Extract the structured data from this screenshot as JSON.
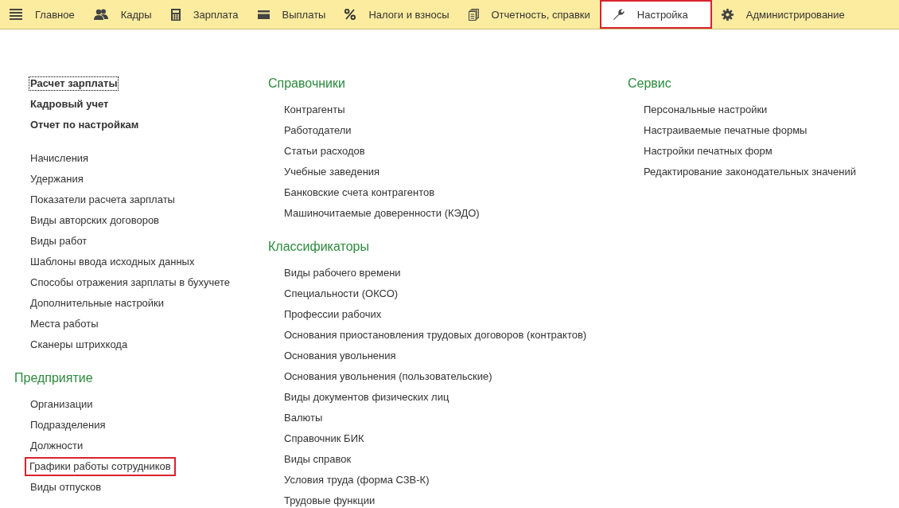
{
  "tabs": [
    {
      "label": "Главное",
      "selected": false,
      "highlighted": false
    },
    {
      "label": "Кадры",
      "selected": false,
      "highlighted": false
    },
    {
      "label": "Зарплата",
      "selected": false,
      "highlighted": false
    },
    {
      "label": "Выплаты",
      "selected": false,
      "highlighted": false
    },
    {
      "label": "Налоги и взносы",
      "selected": false,
      "highlighted": false
    },
    {
      "label": "Отчетность, справки",
      "selected": false,
      "highlighted": false
    },
    {
      "label": "Настройка",
      "selected": true,
      "highlighted": true
    },
    {
      "label": "Администрирование",
      "selected": false,
      "highlighted": false
    }
  ],
  "columns": [
    {
      "sections": [
        {
          "kind": "featured",
          "items": [
            {
              "label": "Расчет зарплаты",
              "focused": true,
              "highlighted": false
            },
            {
              "label": "Кадровый учет",
              "focused": false,
              "highlighted": false
            },
            {
              "label": "Отчет по настройкам",
              "focused": false,
              "highlighted": false
            }
          ]
        },
        {
          "kind": "plain",
          "items": [
            {
              "label": "Начисления",
              "focused": false,
              "highlighted": false
            },
            {
              "label": "Удержания",
              "focused": false,
              "highlighted": false
            },
            {
              "label": "Показатели расчета зарплаты",
              "focused": false,
              "highlighted": false
            },
            {
              "label": "Виды авторских договоров",
              "focused": false,
              "highlighted": false
            },
            {
              "label": "Виды работ",
              "focused": false,
              "highlighted": false
            },
            {
              "label": "Шаблоны ввода исходных данных",
              "focused": false,
              "highlighted": false
            },
            {
              "label": "Способы отражения зарплаты в бухучете",
              "focused": false,
              "highlighted": false
            },
            {
              "label": "Дополнительные настройки",
              "focused": false,
              "highlighted": false
            },
            {
              "label": "Места работы",
              "focused": false,
              "highlighted": false
            },
            {
              "label": "Сканеры штрихкода",
              "focused": false,
              "highlighted": false
            }
          ]
        },
        {
          "kind": "plain",
          "title": "Предприятие",
          "items": [
            {
              "label": "Организации",
              "focused": false,
              "highlighted": false
            },
            {
              "label": "Подразделения",
              "focused": false,
              "highlighted": false
            },
            {
              "label": "Должности",
              "focused": false,
              "highlighted": false
            },
            {
              "label": "Графики работы сотрудников",
              "focused": false,
              "highlighted": true
            },
            {
              "label": "Виды отпусков",
              "focused": false,
              "highlighted": false
            }
          ]
        }
      ]
    },
    {
      "sections": [
        {
          "kind": "plain",
          "title": "Справочники",
          "items": [
            {
              "label": "Контрагенты",
              "focused": false,
              "highlighted": false
            },
            {
              "label": "Работодатели",
              "focused": false,
              "highlighted": false
            },
            {
              "label": "Статьи расходов",
              "focused": false,
              "highlighted": false
            },
            {
              "label": "Учебные заведения",
              "focused": false,
              "highlighted": false
            },
            {
              "label": "Банковские счета контрагентов",
              "focused": false,
              "highlighted": false
            },
            {
              "label": "Машиночитаемые доверенности (КЭДО)",
              "focused": false,
              "highlighted": false
            }
          ]
        },
        {
          "kind": "plain",
          "title": "Классификаторы",
          "items": [
            {
              "label": "Виды рабочего времени",
              "focused": false,
              "highlighted": false
            },
            {
              "label": "Специальности (ОКСО)",
              "focused": false,
              "highlighted": false
            },
            {
              "label": "Профессии рабочих",
              "focused": false,
              "highlighted": false
            },
            {
              "label": "Основания приостановления трудовых договоров (контрактов)",
              "focused": false,
              "highlighted": false
            },
            {
              "label": "Основания увольнения",
              "focused": false,
              "highlighted": false
            },
            {
              "label": "Основания увольнения (пользовательские)",
              "focused": false,
              "highlighted": false
            },
            {
              "label": "Виды документов физических лиц",
              "focused": false,
              "highlighted": false
            },
            {
              "label": "Валюты",
              "focused": false,
              "highlighted": false
            },
            {
              "label": "Справочник БИК",
              "focused": false,
              "highlighted": false
            },
            {
              "label": "Виды справок",
              "focused": false,
              "highlighted": false
            },
            {
              "label": "Условия труда (форма СЗВ-К)",
              "focused": false,
              "highlighted": false
            },
            {
              "label": "Трудовые функции",
              "focused": false,
              "highlighted": false
            }
          ]
        }
      ]
    },
    {
      "sections": [
        {
          "kind": "plain",
          "title": "Сервис",
          "items": [
            {
              "label": "Персональные настройки",
              "focused": false,
              "highlighted": false
            },
            {
              "label": "Настраиваемые печатные формы",
              "focused": false,
              "highlighted": false
            },
            {
              "label": "Настройки печатных форм",
              "focused": false,
              "highlighted": false
            },
            {
              "label": "Редактирование законодательных значений",
              "focused": false,
              "highlighted": false
            }
          ]
        }
      ]
    }
  ]
}
